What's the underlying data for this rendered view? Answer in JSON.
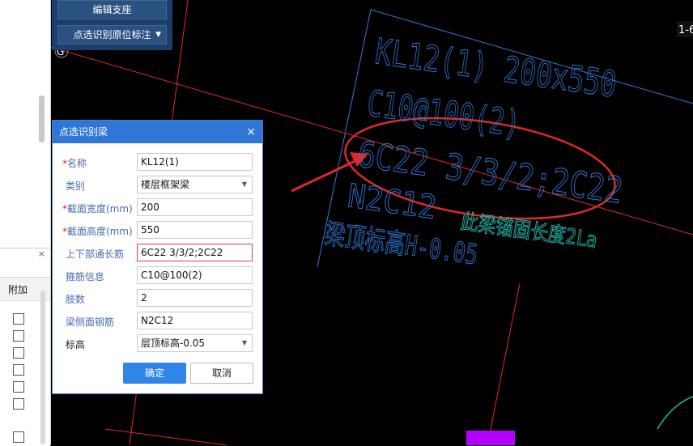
{
  "toolbar": {
    "edit_support": "编辑支座",
    "pick_recognize": "点选识别原位标注"
  },
  "grid": {
    "left_label": "G",
    "right_label": "1-6"
  },
  "cad": {
    "line1": "KL12(1) 200x550",
    "line2": "C10@100(2)",
    "line3": "6C22 3/3/2;2C22",
    "line4": "N2C12",
    "note": "此梁锚固长度2La",
    "top_elev": "梁顶标高H-0.05",
    "annotation_color": "#2f7bd8",
    "note_color": "#1fb8a8",
    "highlight_color": "#e02828"
  },
  "side_panel": {
    "close": "×",
    "column_header": "附加"
  },
  "dialog": {
    "title": "点选识别梁",
    "close": "×",
    "fields": [
      {
        "label": "名称",
        "required": true,
        "value": "KL12(1)",
        "type": "text"
      },
      {
        "label": "类别",
        "required": false,
        "value": "楼层框架梁",
        "type": "select"
      },
      {
        "label": "截面宽度(mm)",
        "required": true,
        "value": "200",
        "type": "text"
      },
      {
        "label": "截面高度(mm)",
        "required": true,
        "value": "550",
        "type": "text"
      },
      {
        "label": "上下部通长筋",
        "required": false,
        "value": "6C22 3/3/2;2C22",
        "type": "text"
      },
      {
        "label": "箍筋信息",
        "required": false,
        "value": "C10@100(2)",
        "type": "text"
      },
      {
        "label": "肢数",
        "required": false,
        "value": "2",
        "type": "text"
      },
      {
        "label": "梁侧面钢筋",
        "required": false,
        "value": "N2C12",
        "type": "text"
      },
      {
        "label": "标高",
        "required": false,
        "value": "层顶标高-0.05",
        "type": "select"
      }
    ],
    "ok": "确定",
    "cancel": "取消"
  }
}
